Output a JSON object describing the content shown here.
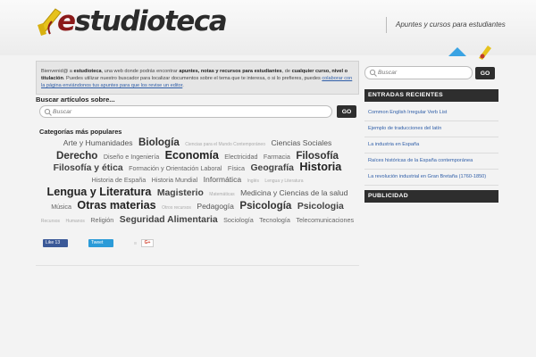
{
  "header": {
    "logo_prefix": "e",
    "logo_text": "studioteca",
    "tagline": "Apuntes y cursos para estudiantes",
    "accent_color": "#8b1a1a",
    "logo_ribbon_color": "#e6c21c"
  },
  "intro": {
    "t1": "Bienvenid@ a ",
    "b1": "estudioteca",
    "t2": ", una web donde podrás encontrar ",
    "b2": "apuntes, notas y recursos para estudiantes",
    "t3": ", de ",
    "b3": "cualquier curso, nivel o titulación",
    "t4": ". Puedes utilizar nuestro buscador para localizar documentos sobre el tema que te interesa, o si lo prefieres, puedes ",
    "link": "colaborar con la página enviándonos tus apuntes para que los revise un editor",
    "t5": "."
  },
  "search": {
    "title": "Buscar artículos sobre...",
    "placeholder": "Buscar",
    "button": "GO"
  },
  "categories": {
    "title": "Categorías más populares",
    "items": [
      {
        "label": "Arte y Humanidades",
        "size": 3
      },
      {
        "label": "Biología",
        "size": 5
      },
      {
        "label": "Ciencias para el Mundo Contemporáneo",
        "size": 1
      },
      {
        "label": "Ciencias Sociales",
        "size": 3
      },
      {
        "label": "Derecho",
        "size": 5
      },
      {
        "label": "Diseño e Ingeniería",
        "size": 2
      },
      {
        "label": "Economía",
        "size": 6
      },
      {
        "label": "Electricidad",
        "size": 2
      },
      {
        "label": "Farmacia",
        "size": 2
      },
      {
        "label": "Filosofía",
        "size": 5
      },
      {
        "label": "Filosofía y ética",
        "size": 4
      },
      {
        "label": "Formación y Orientación Laboral",
        "size": 2
      },
      {
        "label": "Física",
        "size": 2
      },
      {
        "label": "Geografía",
        "size": 4
      },
      {
        "label": "Historia",
        "size": 6
      },
      {
        "label": "Historia de España",
        "size": 2
      },
      {
        "label": "Historia Mundial",
        "size": 2
      },
      {
        "label": "Informática",
        "size": 3
      },
      {
        "label": "Inglés",
        "size": 1
      },
      {
        "label": "Lengua y Literatura",
        "size": 1
      },
      {
        "label": "Lengua y Literatura",
        "size": 6
      },
      {
        "label": "Magisterio",
        "size": 4
      },
      {
        "label": "Matemáticas",
        "size": 1
      },
      {
        "label": "Medicina y Ciencias de la salud",
        "size": 3
      },
      {
        "label": "Música",
        "size": 2
      },
      {
        "label": "Otras materias",
        "size": 6
      },
      {
        "label": "Otros recursos",
        "size": 1
      },
      {
        "label": "Pedagogía",
        "size": 3
      },
      {
        "label": "Psicología",
        "size": 5
      },
      {
        "label": "Psicologia",
        "size": 4
      },
      {
        "label": "Recursos",
        "size": 1
      },
      {
        "label": "Humanos",
        "size": 1
      },
      {
        "label": "Religión",
        "size": 2
      },
      {
        "label": "Seguridad Alimentaria",
        "size": 4
      },
      {
        "label": "Sociología",
        "size": 2
      },
      {
        "label": "Tecnología",
        "size": 2
      },
      {
        "label": "Telecomunicaciones",
        "size": 2
      }
    ]
  },
  "share": {
    "facebook": "Like 13",
    "twitter": "Tweet",
    "gplus": "G+"
  },
  "sidebar": {
    "search_placeholder": "Buscar",
    "search_button": "GO",
    "recent_title": "ENTRADAS RECIENTES",
    "recent": [
      "Common English Irregular Verb List",
      "Ejemplo de traducciones del latín",
      "La industria en España",
      "Raíces históricas de la España contemporánea",
      "La revolución industrial en Gran Bretaña (1760-1850)"
    ],
    "pub_title": "PUBLICIDAD"
  }
}
